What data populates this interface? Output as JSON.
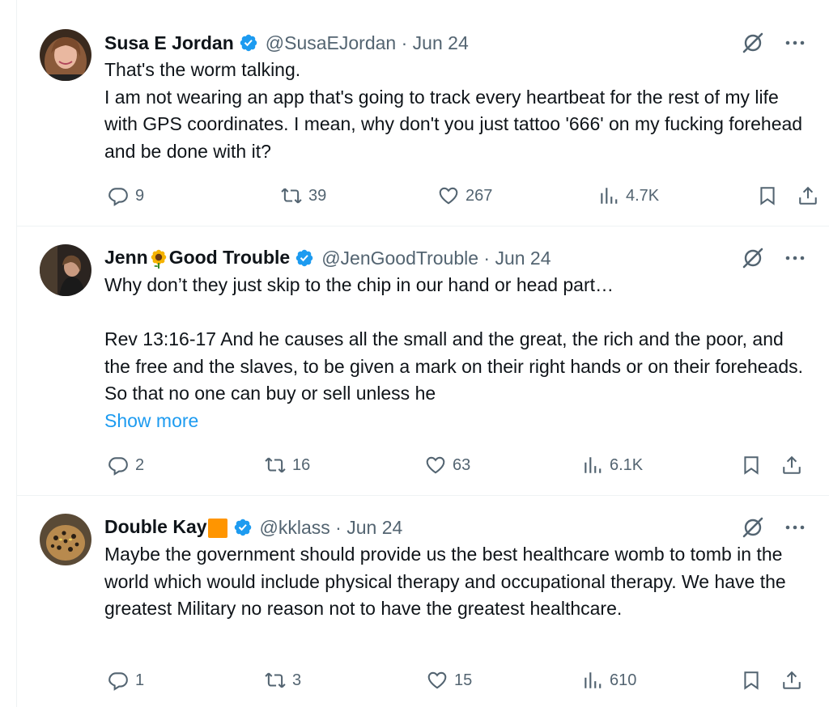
{
  "tweets": [
    {
      "name": "Susa E Jordan",
      "handle": "@SusaEJordan",
      "date": "· Jun 24",
      "lines": [
        "That's the worm talking.",
        "I am not wearing an app that's going to track every heartbeat for the rest of my life with GPS coordinates. I mean, why don't you just tattoo '666' on my fucking forehead and be done with it?"
      ],
      "replies": "9",
      "reposts": "39",
      "likes": "267",
      "views": "4.7K"
    },
    {
      "name_part1": "Jenn",
      "name_part2": "Good Trouble",
      "handle": "@JenGoodTrouble",
      "date": "· Jun 24",
      "line1": "Why don’t they just skip to the chip in our hand or head part…",
      "line2": "Rev 13:16-17 And he causes all the small and the great, the rich and the poor, and the free and the slaves, to be given a mark on their right hands or on their foreheads.  So that no one can buy or sell unless he",
      "show_more": "Show more",
      "replies": "2",
      "reposts": "16",
      "likes": "63",
      "views": "6.1K"
    },
    {
      "name": "Double Kay",
      "handle": "@kklass",
      "date": "· Jun 24",
      "text": "Maybe the government should provide us the best healthcare womb to tomb in the world which would include physical therapy and occupational therapy. We have the greatest Military no reason not to have the greatest healthcare.",
      "replies": "1",
      "reposts": "3",
      "likes": "15",
      "views": "610"
    }
  ],
  "icons": {
    "verified": "verified-badge-icon",
    "grok": "grok-icon",
    "more": "more-icon",
    "reply": "reply-icon",
    "repost": "repost-icon",
    "like": "like-icon",
    "views": "views-icon",
    "bookmark": "bookmark-icon",
    "share": "share-icon",
    "sunflower": "sunflower-emoji",
    "orange_square": "orange-square-emoji"
  },
  "colors": {
    "text": "#0f1419",
    "muted": "#536471",
    "link": "#1d9bf0",
    "verified": "#1d9bf0",
    "orange": "#ff9500"
  }
}
